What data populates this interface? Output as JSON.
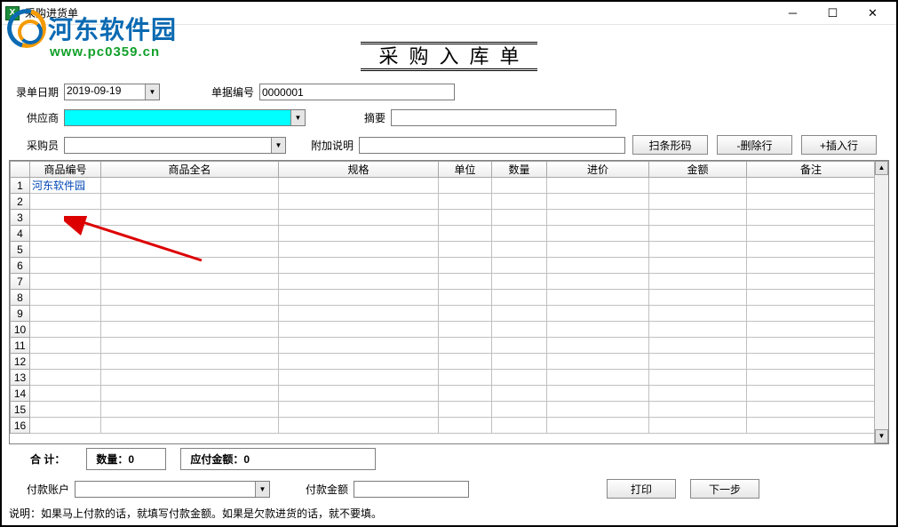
{
  "window": {
    "title": "采购进货单"
  },
  "watermark": {
    "name": "河东软件园",
    "url": "www.pc0359.cn"
  },
  "page": {
    "title": "采购入库单"
  },
  "form": {
    "date_label": "录单日期",
    "date_value": "2019-09-19",
    "docno_label": "单据编号",
    "docno_value": "0000001",
    "supplier_label": "供应商",
    "supplier_value": "",
    "summary_label": "摘要",
    "summary_value": "",
    "buyer_label": "采购员",
    "buyer_value": "",
    "extra_label": "附加说明",
    "extra_value": "",
    "btn_barcode": "扫条形码",
    "btn_delrow": "-删除行",
    "btn_addrow": "+插入行"
  },
  "grid": {
    "headers": [
      "商品编号",
      "商品全名",
      "规格",
      "单位",
      "数量",
      "进价",
      "金额",
      "备注"
    ],
    "widths": [
      80,
      200,
      180,
      60,
      62,
      115,
      110,
      145
    ],
    "rows": [
      {
        "num": 1,
        "cells": [
          "河东软件园",
          "",
          "",
          "",
          "",
          "",
          "",
          ""
        ]
      },
      {
        "num": 2,
        "cells": [
          "",
          "",
          "",
          "",
          "",
          "",
          "",
          ""
        ]
      },
      {
        "num": 3,
        "cells": [
          "",
          "",
          "",
          "",
          "",
          "",
          "",
          ""
        ]
      },
      {
        "num": 4,
        "cells": [
          "",
          "",
          "",
          "",
          "",
          "",
          "",
          ""
        ]
      },
      {
        "num": 5,
        "cells": [
          "",
          "",
          "",
          "",
          "",
          "",
          "",
          ""
        ]
      },
      {
        "num": 6,
        "cells": [
          "",
          "",
          "",
          "",
          "",
          "",
          "",
          ""
        ]
      },
      {
        "num": 7,
        "cells": [
          "",
          "",
          "",
          "",
          "",
          "",
          "",
          ""
        ]
      },
      {
        "num": 8,
        "cells": [
          "",
          "",
          "",
          "",
          "",
          "",
          "",
          ""
        ]
      },
      {
        "num": 9,
        "cells": [
          "",
          "",
          "",
          "",
          "",
          "",
          "",
          ""
        ]
      },
      {
        "num": 10,
        "cells": [
          "",
          "",
          "",
          "",
          "",
          "",
          "",
          ""
        ]
      },
      {
        "num": 11,
        "cells": [
          "",
          "",
          "",
          "",
          "",
          "",
          "",
          ""
        ]
      },
      {
        "num": 12,
        "cells": [
          "",
          "",
          "",
          "",
          "",
          "",
          "",
          ""
        ]
      },
      {
        "num": 13,
        "cells": [
          "",
          "",
          "",
          "",
          "",
          "",
          "",
          ""
        ]
      },
      {
        "num": 14,
        "cells": [
          "",
          "",
          "",
          "",
          "",
          "",
          "",
          ""
        ]
      },
      {
        "num": 15,
        "cells": [
          "",
          "",
          "",
          "",
          "",
          "",
          "",
          ""
        ]
      },
      {
        "num": 16,
        "cells": [
          "",
          "",
          "",
          "",
          "",
          "",
          "",
          ""
        ]
      }
    ]
  },
  "totals": {
    "label": "合 计：",
    "qty_label": "数量：",
    "qty_value": "0",
    "amount_label": "应付金额：",
    "amount_value": "0"
  },
  "footer": {
    "account_label": "付款账户",
    "account_value": "",
    "payamount_label": "付款金额",
    "payamount_value": "",
    "btn_print": "打印",
    "btn_next": "下一步"
  },
  "note": "说明：如果马上付款的话，就填写付款金额。如果是欠款进货的话，就不要填。"
}
